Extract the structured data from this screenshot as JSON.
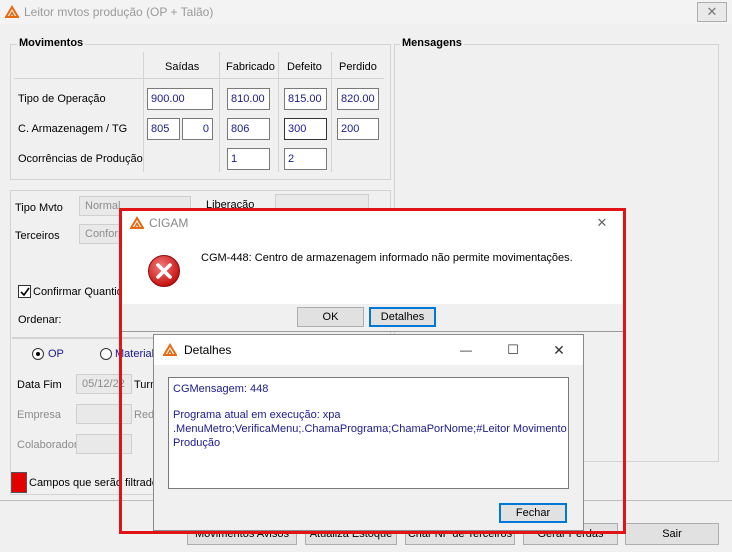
{
  "window": {
    "title": "Leitor mvtos produção (OP + Talão)",
    "close_glyph": "✕"
  },
  "movimentos": {
    "group_label": "Movimentos",
    "columns": {
      "saidas": "Saídas",
      "fabricado": "Fabricado",
      "defeito": "Defeito",
      "perdido": "Perdido"
    },
    "rows": {
      "tipo_operacao": {
        "label": "Tipo de Operação",
        "saidas": "900.00",
        "fabricado": "810.00",
        "defeito": "815.00",
        "perdido": "820.00"
      },
      "armazenagem": {
        "label": "C. Armazenagem / TG",
        "saidas": "805",
        "tg": "0",
        "fabricado": "806",
        "defeito": "300",
        "perdido": "200"
      },
      "ocorrencias": {
        "label": "Ocorrências de Produção",
        "fabricado": "1",
        "defeito": "2"
      }
    }
  },
  "mensagens": {
    "group_label": "Mensagens"
  },
  "options": {
    "tipo_mvto_label": "Tipo Mvto",
    "tipo_mvto_value": "Normal",
    "terceiros_label": "Terceiros",
    "terceiros_value": "Conforme",
    "liberacao_label": "Liberação",
    "confirmar_label": "Confirmar Quantid",
    "ordenar_label": "Ordenar:",
    "radio_op": "OP",
    "radio_material": "Material",
    "data_fim_label": "Data Fim",
    "data_fim_value": "05/12/22",
    "turno_label": "Turn",
    "empresa_label": "Empresa",
    "red_label": "Red",
    "colaborador_label": "Colaborador",
    "legend_label": "Campos que serão filtrados"
  },
  "bottom_buttons": {
    "movimentos_avisos": "Movimentos Avisos",
    "atualiza_estoque": "Atualiza Estoque",
    "criar_nf": "Criar NF de Terceiros",
    "gerar_perdas": "Gerar Perdas",
    "sair": "Sair"
  },
  "error_dialog": {
    "title": "CIGAM",
    "message": "CGM-448: Centro de armazenagem informado não permite movimentações.",
    "ok": "OK",
    "detalhes": "Detalhes",
    "close_glyph": "✕"
  },
  "details_dialog": {
    "title": "Detalhes",
    "minimize_glyph": "—",
    "maximize_glyph": "☐",
    "close_glyph": "✕",
    "text_line1": "CGMensagem: 448",
    "text_line2": "Programa atual em execução: xpa",
    "text_line3": ".MenuMetro;VerificaMenu;.ChamaPrograma;ChamaPorNome;#Leitor Movimento",
    "text_line4": "Produção",
    "fechar": "Fechar"
  },
  "colors": {
    "error_red": "#d81e1e",
    "highlight_frame": "#e01414",
    "field_text": "#1a1a8c",
    "legend_swatch": "#e50000"
  }
}
